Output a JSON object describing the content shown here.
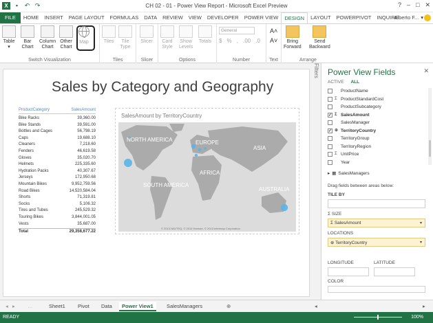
{
  "window": {
    "title": "CH 02 - 01 - Power View Report - Microsoft Excel Preview",
    "user": "Alberto F...",
    "ctrl_help": "?",
    "ctrl_min": "–",
    "ctrl_max": "□",
    "ctrl_close": "✕"
  },
  "ribbon_tabs": [
    "FILE",
    "HOME",
    "INSERT",
    "PAGE LAYOUT",
    "FORMULAS",
    "DATA",
    "REVIEW",
    "VIEW",
    "DEVELOPER",
    "POWER VIEW",
    "DESIGN",
    "LAYOUT",
    "POWERPIVOT",
    "INQUIRE"
  ],
  "ribbon": {
    "groups": {
      "switch": "Switch Visualization",
      "tiles": "Tiles",
      "slicer": "Slicer",
      "options": "Options",
      "number": "Number",
      "text": "Text",
      "arrange": "Arrange"
    },
    "buttons": {
      "table": "Table",
      "bar": "Bar",
      "column": "Column",
      "other": "Other",
      "chart": "Chart",
      "map": "Map",
      "tiles": "Tiles",
      "tile": "Tile",
      "type": "Type",
      "slicer": "Slicer",
      "card": "Card",
      "style": "Style",
      "show": "Show",
      "levels": "Levels",
      "totals": "Totals",
      "bring": "Bring",
      "forward": "Forward",
      "send": "Send",
      "backward": "Backward"
    },
    "number_format": "General",
    "number_symbols": [
      "$",
      "%",
      ",",
      ".00",
      ".0"
    ],
    "font_grow": "A˄",
    "font_shrink": "A˅"
  },
  "report": {
    "title": "Sales by Category and Geography",
    "table": {
      "headers": [
        "ProductCategory",
        "SalesAmount"
      ],
      "rows": [
        [
          "Bike Racks",
          "39,360.00"
        ],
        [
          "Bike Stands",
          "39,591.00"
        ],
        [
          "Bottles and Cages",
          "56,798.19"
        ],
        [
          "Caps",
          "19,688.10"
        ],
        [
          "Cleaners",
          "7,218.60"
        ],
        [
          "Fenders",
          "46,619.58"
        ],
        [
          "Gloves",
          "35,020.70"
        ],
        [
          "Helmets",
          "225,335.60"
        ],
        [
          "Hydration Packs",
          "40,307.67"
        ],
        [
          "Jerseys",
          "172,950.68"
        ],
        [
          "Mountain Bikes",
          "9,952,759.56"
        ],
        [
          "Road Bikes",
          "14,520,584.04"
        ],
        [
          "Shorts",
          "71,319.81"
        ],
        [
          "Socks",
          "5,106.32"
        ],
        [
          "Tires and Tubes",
          "245,529.32"
        ],
        [
          "Touring Bikes",
          "3,844,001.05"
        ],
        [
          "Vests",
          "35,687.00"
        ]
      ],
      "total_label": "Total",
      "total_value": "29,358,677.22"
    },
    "map": {
      "title": "SalesAmount by TerritoryCountry",
      "labels": [
        "NORTH AMERICA",
        "EUROPE",
        "ASIA",
        "AFRICA",
        "SOUTH AMERICA",
        "AUSTRALIA"
      ],
      "copyright": "© 2013 NAVTEQ, © 2013 Harman, © 2013 Intermap Corporation"
    },
    "filters_label": "Filters"
  },
  "panel": {
    "title": "Power View Fields",
    "tabs": [
      "ACTIVE",
      "ALL"
    ],
    "fields": [
      {
        "name": "ProductName",
        "checked": false,
        "sigma": false,
        "bold": false
      },
      {
        "name": "ProductStandardCost",
        "checked": false,
        "sigma": true,
        "bold": false
      },
      {
        "name": "ProductSubcategory",
        "checked": false,
        "sigma": false,
        "bold": false
      },
      {
        "name": "SalesAmount",
        "checked": true,
        "sigma": true,
        "bold": true
      },
      {
        "name": "SalesManager",
        "checked": false,
        "sigma": false,
        "bold": false
      },
      {
        "name": "TerritoryCountry",
        "checked": true,
        "sigma": false,
        "bold": true
      },
      {
        "name": "TerritoryGroup",
        "checked": false,
        "sigma": false,
        "bold": false
      },
      {
        "name": "TerritoryRegion",
        "checked": false,
        "sigma": false,
        "bold": false
      },
      {
        "name": "UnitPrice",
        "checked": false,
        "sigma": true,
        "bold": false
      },
      {
        "name": "Year",
        "checked": false,
        "sigma": false,
        "bold": false
      }
    ],
    "table_item": "SalesManagers",
    "drag_hint": "Drag fields between areas below:",
    "zones": {
      "tile_by": "TILE BY",
      "size": "SIZE",
      "size_value": "SalesAmount",
      "locations": "LOCATIONS",
      "locations_value": "TerritoryCountry",
      "longitude": "LONGITUDE",
      "latitude": "LATITUDE",
      "color": "COLOR"
    }
  },
  "sheet_tabs": [
    "Sheet1",
    "Pivot",
    "Data",
    "Power View1",
    "SalesManagers"
  ],
  "active_sheet": "Power View1",
  "status": {
    "ready": "READY",
    "zoom": "100%"
  },
  "colors": {
    "accent": "#217346",
    "bubble": "#5ab4e5",
    "table_header": "#5a8ab8"
  }
}
